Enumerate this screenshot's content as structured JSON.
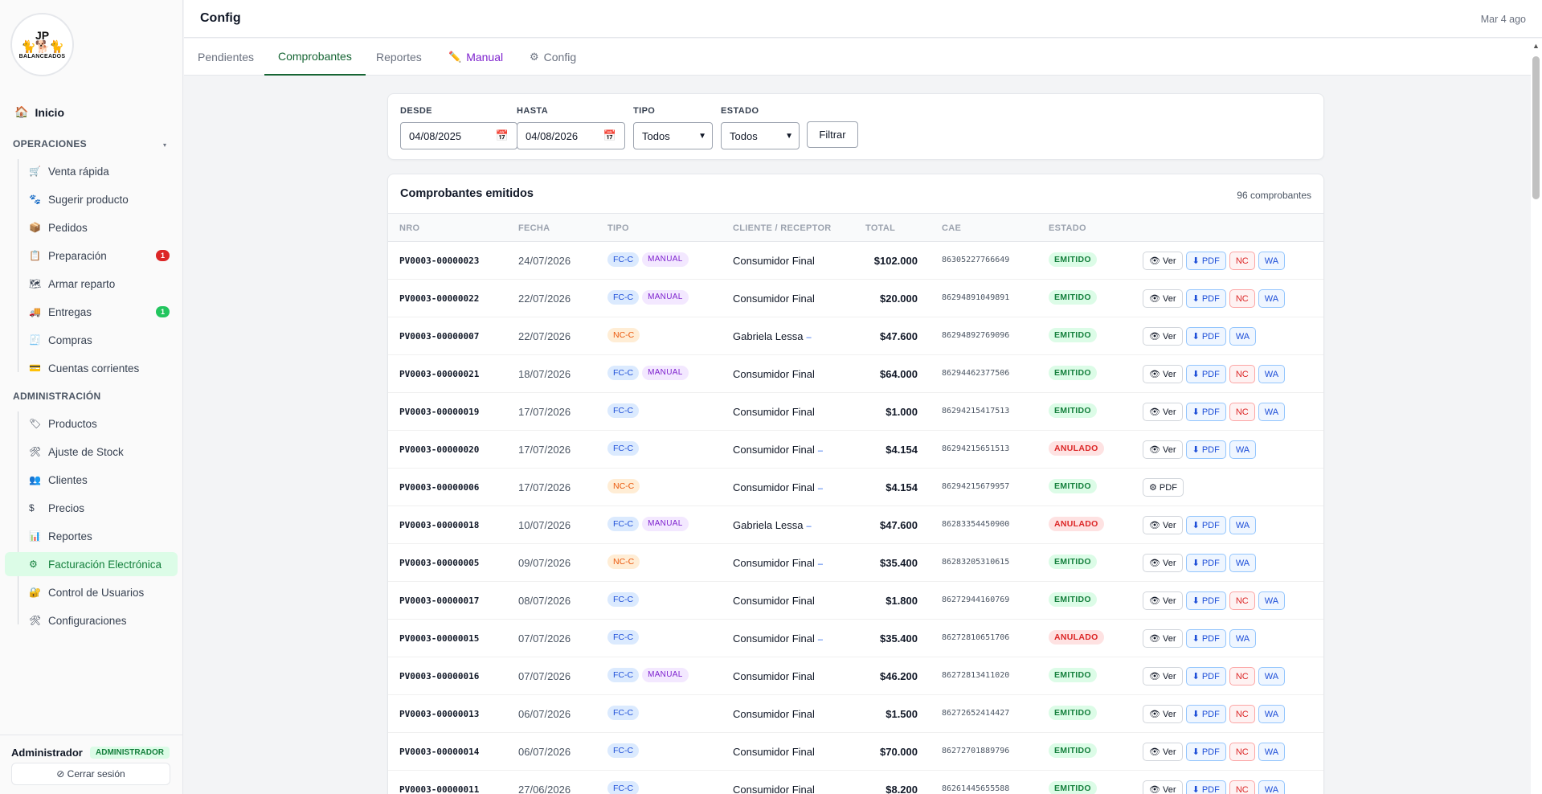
{
  "logo": {
    "initials": "JP",
    "name": "BALANCEADOS"
  },
  "sidebar": {
    "home": "Inicio",
    "sections": [
      {
        "label": "OPERACIONES",
        "items": [
          {
            "label": "Venta rápida",
            "icon": "cart-icon",
            "glyph": "🛒"
          },
          {
            "label": "Sugerir producto",
            "icon": "paw-icon",
            "glyph": "🐾"
          },
          {
            "label": "Pedidos",
            "icon": "box-icon",
            "glyph": "📦"
          },
          {
            "label": "Preparación",
            "icon": "clipboard-icon",
            "glyph": "📋",
            "badge": "1",
            "badge_color": "#dc2626"
          },
          {
            "label": "Armar reparto",
            "icon": "map-icon",
            "glyph": "🗺"
          },
          {
            "label": "Entregas",
            "icon": "truck-icon",
            "glyph": "🚚",
            "badge": "1",
            "badge_color": "#22c55e"
          },
          {
            "label": "Compras",
            "icon": "receipt-icon",
            "glyph": "🧾"
          },
          {
            "label": "Cuentas corrientes",
            "icon": "card-icon",
            "glyph": "💳"
          }
        ]
      },
      {
        "label": "ADMINISTRACIÓN",
        "items": [
          {
            "label": "Productos",
            "icon": "tag-icon",
            "glyph": "🏷"
          },
          {
            "label": "Ajuste de Stock",
            "icon": "tools-icon",
            "glyph": "🛠"
          },
          {
            "label": "Clientes",
            "icon": "users-icon",
            "glyph": "👥"
          },
          {
            "label": "Precios",
            "icon": "dollar-icon",
            "glyph": "$"
          },
          {
            "label": "Reportes",
            "icon": "chart-icon",
            "glyph": "📊"
          },
          {
            "label": "Facturación Electrónica",
            "icon": "gear-icon",
            "glyph": "⚙",
            "active": true
          },
          {
            "label": "Control de Usuarios",
            "icon": "lock-icon",
            "glyph": "🔐"
          },
          {
            "label": "Configuraciones",
            "icon": "tools-icon",
            "glyph": "🛠"
          }
        ]
      }
    ],
    "user": {
      "name": "Administrador",
      "role": "ADMINISTRADOR",
      "logout": "⊘ Cerrar sesión"
    }
  },
  "header": {
    "title": "Config",
    "date": "Mar 4 ago"
  },
  "tabs": [
    {
      "label": "Pendientes"
    },
    {
      "label": "Comprobantes",
      "active": true
    },
    {
      "label": "Reportes"
    },
    {
      "label": "Manual",
      "icon": "pencil-icon",
      "glyph": "✏️"
    },
    {
      "label": "Config",
      "icon": "gear-icon",
      "glyph": "⚙"
    }
  ],
  "filters": {
    "desde": {
      "label": "DESDE",
      "value": "04/08/2025"
    },
    "hasta": {
      "label": "HASTA",
      "value": "04/08/2026"
    },
    "tipo": {
      "label": "TIPO",
      "value": "Todos"
    },
    "estado": {
      "label": "ESTADO",
      "value": "Todos"
    },
    "button": "Filtrar"
  },
  "table": {
    "title": "Comprobantes emitidos",
    "count": "96 comprobantes",
    "columns": [
      "NRO",
      "FECHA",
      "TIPO",
      "CLIENTE / RECEPTOR",
      "TOTAL",
      "CAE",
      "ESTADO"
    ],
    "rows": [
      {
        "nro": "PV0003-00000023",
        "fecha": "24/07/2026",
        "tipo": "FC-C",
        "manual": "MANUAL",
        "cliente": "Consumidor Final",
        "dash": "",
        "total": "$102.000",
        "cae": "86305227766649",
        "estado": "EMITIDO",
        "actions": [
          "👁 Ver",
          "⬇ PDF",
          "NC",
          "WA"
        ]
      },
      {
        "nro": "PV0003-00000022",
        "fecha": "22/07/2026",
        "tipo": "FC-C",
        "manual": "MANUAL",
        "cliente": "Consumidor Final",
        "dash": "",
        "total": "$20.000",
        "cae": "86294891049891",
        "estado": "EMITIDO",
        "actions": [
          "👁 Ver",
          "⬇ PDF",
          "NC",
          "WA"
        ]
      },
      {
        "nro": "PV0003-00000007",
        "fecha": "22/07/2026",
        "tipo": "NC-C",
        "manual": "",
        "cliente": "Gabriela Lessa",
        "dash": "–",
        "total": "$47.600",
        "cae": "86294892769096",
        "estado": "EMITIDO",
        "actions": [
          "👁 Ver",
          "⬇ PDF",
          "WA"
        ]
      },
      {
        "nro": "PV0003-00000021",
        "fecha": "18/07/2026",
        "tipo": "FC-C",
        "manual": "MANUAL",
        "cliente": "Consumidor Final",
        "dash": "",
        "total": "$64.000",
        "cae": "86294462377506",
        "estado": "EMITIDO",
        "actions": [
          "👁 Ver",
          "⬇ PDF",
          "NC",
          "WA"
        ]
      },
      {
        "nro": "PV0003-00000019",
        "fecha": "17/07/2026",
        "tipo": "FC-C",
        "manual": "",
        "cliente": "Consumidor Final",
        "dash": "",
        "total": "$1.000",
        "cae": "86294215417513",
        "estado": "EMITIDO",
        "actions": [
          "👁 Ver",
          "⬇ PDF",
          "NC",
          "WA"
        ]
      },
      {
        "nro": "PV0003-00000020",
        "fecha": "17/07/2026",
        "tipo": "FC-C",
        "manual": "",
        "cliente": "Consumidor Final",
        "dash": "–",
        "total": "$4.154",
        "cae": "86294215651513",
        "estado": "ANULADO",
        "actions": [
          "👁 Ver",
          "⬇ PDF",
          "WA"
        ]
      },
      {
        "nro": "PV0003-00000006",
        "fecha": "17/07/2026",
        "tipo": "NC-C",
        "manual": "",
        "cliente": "Consumidor Final",
        "dash": "–",
        "total": "$4.154",
        "cae": "86294215679957",
        "estado": "EMITIDO",
        "actions": [
          "⚙ PDF"
        ]
      },
      {
        "nro": "PV0003-00000018",
        "fecha": "10/07/2026",
        "tipo": "FC-C",
        "manual": "MANUAL",
        "cliente": "Gabriela Lessa",
        "dash": "–",
        "total": "$47.600",
        "cae": "86283354450900",
        "estado": "ANULADO",
        "actions": [
          "👁 Ver",
          "⬇ PDF",
          "WA"
        ]
      },
      {
        "nro": "PV0003-00000005",
        "fecha": "09/07/2026",
        "tipo": "NC-C",
        "manual": "",
        "cliente": "Consumidor Final",
        "dash": "–",
        "total": "$35.400",
        "cae": "86283205310615",
        "estado": "EMITIDO",
        "actions": [
          "👁 Ver",
          "⬇ PDF",
          "WA"
        ]
      },
      {
        "nro": "PV0003-00000017",
        "fecha": "08/07/2026",
        "tipo": "FC-C",
        "manual": "",
        "cliente": "Consumidor Final",
        "dash": "",
        "total": "$1.800",
        "cae": "86272944160769",
        "estado": "EMITIDO",
        "actions": [
          "👁 Ver",
          "⬇ PDF",
          "NC",
          "WA"
        ]
      },
      {
        "nro": "PV0003-00000015",
        "fecha": "07/07/2026",
        "tipo": "FC-C",
        "manual": "",
        "cliente": "Consumidor Final",
        "dash": "–",
        "total": "$35.400",
        "cae": "86272810651706",
        "estado": "ANULADO",
        "actions": [
          "👁 Ver",
          "⬇ PDF",
          "WA"
        ]
      },
      {
        "nro": "PV0003-00000016",
        "fecha": "07/07/2026",
        "tipo": "FC-C",
        "manual": "MANUAL",
        "cliente": "Consumidor Final",
        "dash": "",
        "total": "$46.200",
        "cae": "86272813411020",
        "estado": "EMITIDO",
        "actions": [
          "👁 Ver",
          "⬇ PDF",
          "NC",
          "WA"
        ]
      },
      {
        "nro": "PV0003-00000013",
        "fecha": "06/07/2026",
        "tipo": "FC-C",
        "manual": "",
        "cliente": "Consumidor Final",
        "dash": "",
        "total": "$1.500",
        "cae": "86272652414427",
        "estado": "EMITIDO",
        "actions": [
          "👁 Ver",
          "⬇ PDF",
          "NC",
          "WA"
        ]
      },
      {
        "nro": "PV0003-00000014",
        "fecha": "06/07/2026",
        "tipo": "FC-C",
        "manual": "",
        "cliente": "Consumidor Final",
        "dash": "",
        "total": "$70.000",
        "cae": "86272701889796",
        "estado": "EMITIDO",
        "actions": [
          "👁 Ver",
          "⬇ PDF",
          "NC",
          "WA"
        ]
      },
      {
        "nro": "PV0003-00000011",
        "fecha": "27/06/2026",
        "tipo": "FC-C",
        "manual": "",
        "cliente": "Consumidor Final",
        "dash": "",
        "total": "$8.200",
        "cae": "86261445655588",
        "estado": "EMITIDO",
        "actions": [
          "👁 Ver",
          "⬇ PDF",
          "NC",
          "WA"
        ]
      }
    ]
  }
}
